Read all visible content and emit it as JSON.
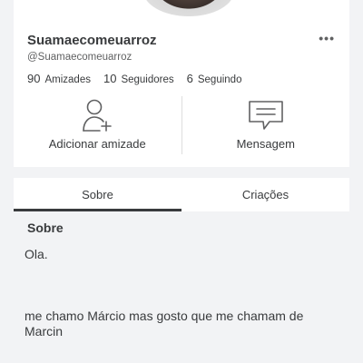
{
  "profile": {
    "username": "Suamaecomeuarroz",
    "handle": "@Suamaecomeuarroz",
    "more_icon": "more-horizontal-icon",
    "stats": [
      {
        "value": "90",
        "label": "Amizades"
      },
      {
        "value": "10",
        "label": "Seguidores"
      },
      {
        "value": "6",
        "label": "Seguindo"
      }
    ]
  },
  "actions": {
    "add_friend": {
      "label": "Adicionar amizade",
      "icon": "add-friend-icon"
    },
    "message": {
      "label": "Mensagem",
      "icon": "message-icon"
    }
  },
  "tabs": [
    {
      "label": "Sobre",
      "active": true
    },
    {
      "label": "Criações",
      "active": false
    }
  ],
  "about": {
    "title": "Sobre",
    "text": "Ola.\n\n\n\nme chamo Márcio mas gosto que me chamam de Marcin"
  },
  "colors": {
    "text": "#393b3d",
    "secondary_text": "#606162",
    "background": "#f2f3f5",
    "card": "#ffffff"
  }
}
